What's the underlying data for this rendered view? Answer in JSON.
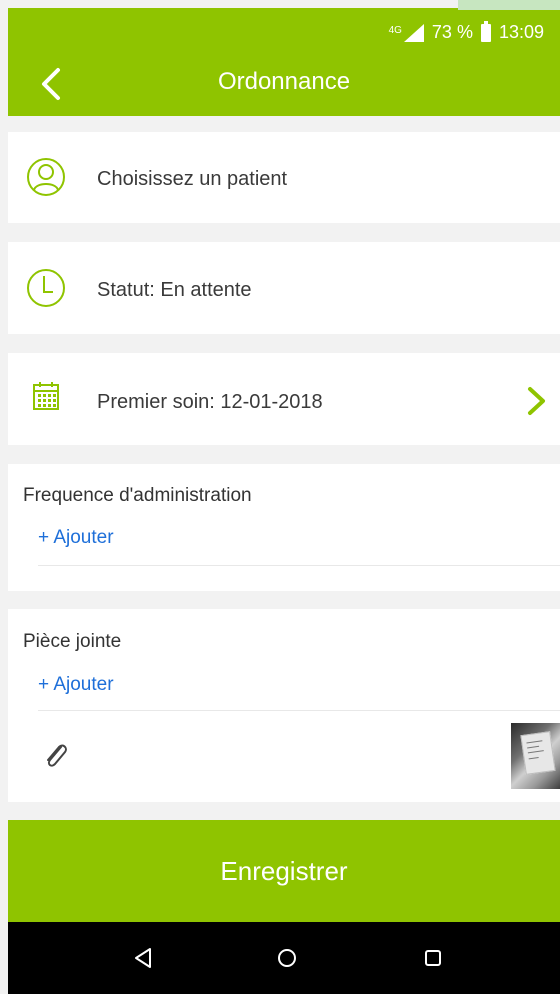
{
  "status_bar": {
    "network": "4G",
    "battery_text": "73 %",
    "time": "13:09"
  },
  "app_bar": {
    "title": "Ordonnance"
  },
  "patient": {
    "label": "Choisissez un patient"
  },
  "status": {
    "label": "Statut: En attente"
  },
  "first_care": {
    "label": "Premier soin: 12-01-2018"
  },
  "frequency": {
    "title": "Frequence d'administration",
    "add_label": "+ Ajouter"
  },
  "attachment": {
    "title": "Pièce jointe",
    "add_label": "+ Ajouter"
  },
  "save": {
    "label": "Enregistrer"
  },
  "colors": {
    "brand": "#8fc400",
    "link": "#1e6fd9"
  },
  "icons": {
    "back": "chevron-left-icon",
    "patient": "user-icon",
    "status": "clock-icon",
    "first_care": "calendar-icon",
    "first_care_action": "chevron-right-icon",
    "attachment": "paperclip-icon",
    "nav_back": "nav-back-icon",
    "nav_home": "nav-home-icon",
    "nav_recents": "nav-recents-icon"
  }
}
